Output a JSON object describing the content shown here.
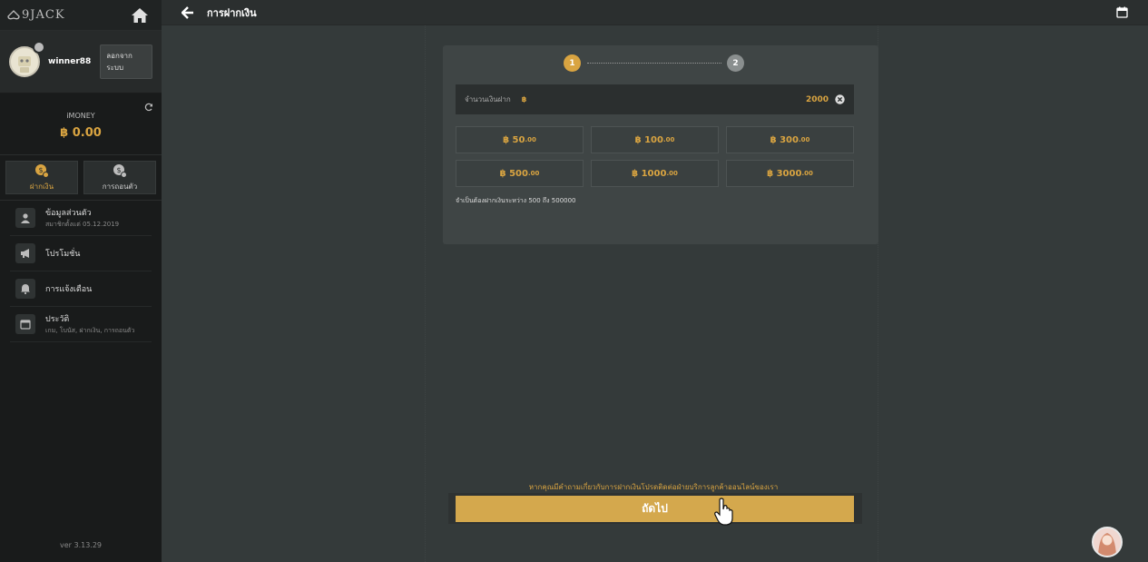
{
  "sidebar": {
    "logo": "9JACK",
    "username": "winner88",
    "logout_label": "ลอกจากระบบ",
    "money_label": "iMONEY",
    "money_value": "฿ 0.00",
    "actions": [
      {
        "label": "ฝากเงิน",
        "icon": "deposit-coin-icon"
      },
      {
        "label": "การถอนตัว",
        "icon": "withdraw-coin-icon"
      }
    ],
    "menu": [
      {
        "title": "ข้อมูลส่วนตัว",
        "sub": "สมาชิกตั้งแต่ 05.12.2019",
        "icon": "user-icon"
      },
      {
        "title": "โปรโมชั่น",
        "sub": "",
        "icon": "megaphone-icon"
      },
      {
        "title": "การแจ้งเตือน",
        "sub": "",
        "icon": "bell-icon"
      },
      {
        "title": "ประวัติ",
        "sub": "เกม, โบนัส, ฝากเงิน, การถอนตัว",
        "icon": "calendar-icon"
      }
    ],
    "version": "ver 3.13.29"
  },
  "topbar": {
    "title": "การฝากเงิน"
  },
  "steps": {
    "step1": "1",
    "step2": "2"
  },
  "amount": {
    "label": "จำนวนเงินฝาก",
    "currency": "฿",
    "value": "2000"
  },
  "presets": [
    {
      "main": "฿ 50",
      "dec": ".00"
    },
    {
      "main": "฿ 100",
      "dec": ".00"
    },
    {
      "main": "฿ 300",
      "dec": ".00"
    },
    {
      "main": "฿ 500",
      "dec": ".00"
    },
    {
      "main": "฿ 1000",
      "dec": ".00"
    },
    {
      "main": "฿ 3000",
      "dec": ".00"
    }
  ],
  "limit_note": "จำเป็นต้องฝากเงินระหว่าง 500 ถึง 500000",
  "help_text": "หากคุณมีคำถามเกี่ยวกับการฝากเงินโปรดติดต่อฝ่ายบริการลูกค้าออนไลน์ของเรา",
  "next_label": "ถัดไป",
  "colors": {
    "accent": "#d9a441",
    "background": "#343a3a",
    "sidebar": "#191b1b"
  }
}
